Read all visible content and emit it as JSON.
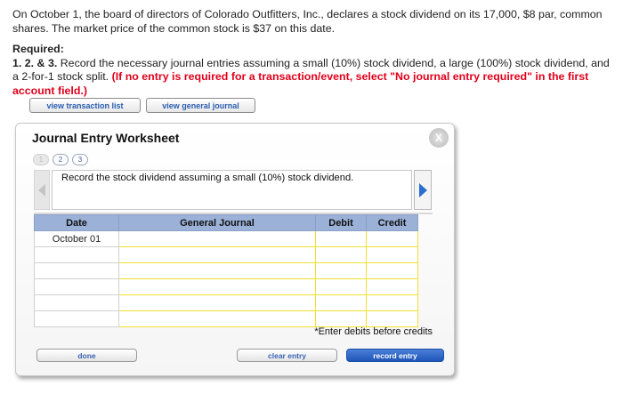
{
  "intro": "On October 1, the board of directors of Colorado Outfitters, Inc., declares a stock dividend on its 17,000, $8 par, common shares. The market price of the common stock is $37 on this date.",
  "required": {
    "heading": "Required:",
    "numbers": "1. 2. & 3.",
    "text": " Record the necessary journal entries assuming a small (10%) stock dividend, a large (100%) stock dividend, and a 2-for-1 stock split. ",
    "instruction": "(If no entry is required for a transaction/event, select \"No journal entry required\" in the first account field.)"
  },
  "top_buttons": {
    "view_transaction_list": "view transaction list",
    "view_general_journal": "view general journal"
  },
  "worksheet": {
    "title": "Journal Entry Worksheet",
    "close_glyph": "X",
    "steps": [
      "1",
      "2",
      "3"
    ],
    "prompt": "Record the stock dividend assuming a small (10%) stock dividend.",
    "columns": [
      "Date",
      "General Journal",
      "Debit",
      "Credit"
    ],
    "rows": [
      {
        "date": "October 01",
        "account": "",
        "debit": "",
        "credit": ""
      },
      {
        "date": "",
        "account": "",
        "debit": "",
        "credit": ""
      },
      {
        "date": "",
        "account": "",
        "debit": "",
        "credit": ""
      },
      {
        "date": "",
        "account": "",
        "debit": "",
        "credit": ""
      },
      {
        "date": "",
        "account": "",
        "debit": "",
        "credit": ""
      },
      {
        "date": "",
        "account": "",
        "debit": "",
        "credit": ""
      }
    ],
    "note": "*Enter debits before credits",
    "buttons": {
      "done": "done",
      "clear_entry": "clear entry",
      "record_entry": "record entry"
    }
  },
  "colors": {
    "header_blue": "#9bb1d8",
    "instruction_red": "#e0001b",
    "input_yellow": "#f0e030",
    "record_blue": "#1e55b8"
  }
}
